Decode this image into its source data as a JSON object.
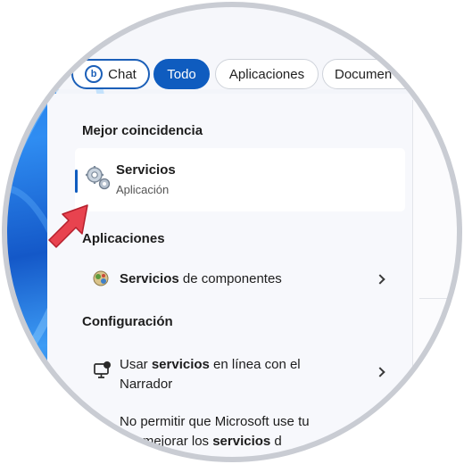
{
  "tabs": {
    "chat": "Chat",
    "todo": "Todo",
    "apps": "Aplicaciones",
    "docs": "Documen"
  },
  "best_match": {
    "heading": "Mejor coincidencia",
    "title": "Servicios",
    "subtitle": "Aplicación",
    "icon": "gears-icon"
  },
  "apps_section": {
    "heading": "Aplicaciones",
    "item": {
      "bold": "Servicios",
      "rest": " de componentes",
      "icon": "component-services-icon"
    }
  },
  "settings_section": {
    "heading": "Configuración",
    "item1": {
      "prefix": "Usar ",
      "bold": "servicios",
      "suffix": " en línea con el",
      "line2": "Narrador",
      "icon": "narrator-icon"
    },
    "item2": {
      "line1": "No permitir que Microsoft use tu",
      "line2_prefix": "ara mejorar los ",
      "line2_bold": "servicios",
      "line2_suffix": " d"
    }
  },
  "colors": {
    "accent": "#0f5cbf",
    "pointer_arrow": "#e8434f"
  }
}
